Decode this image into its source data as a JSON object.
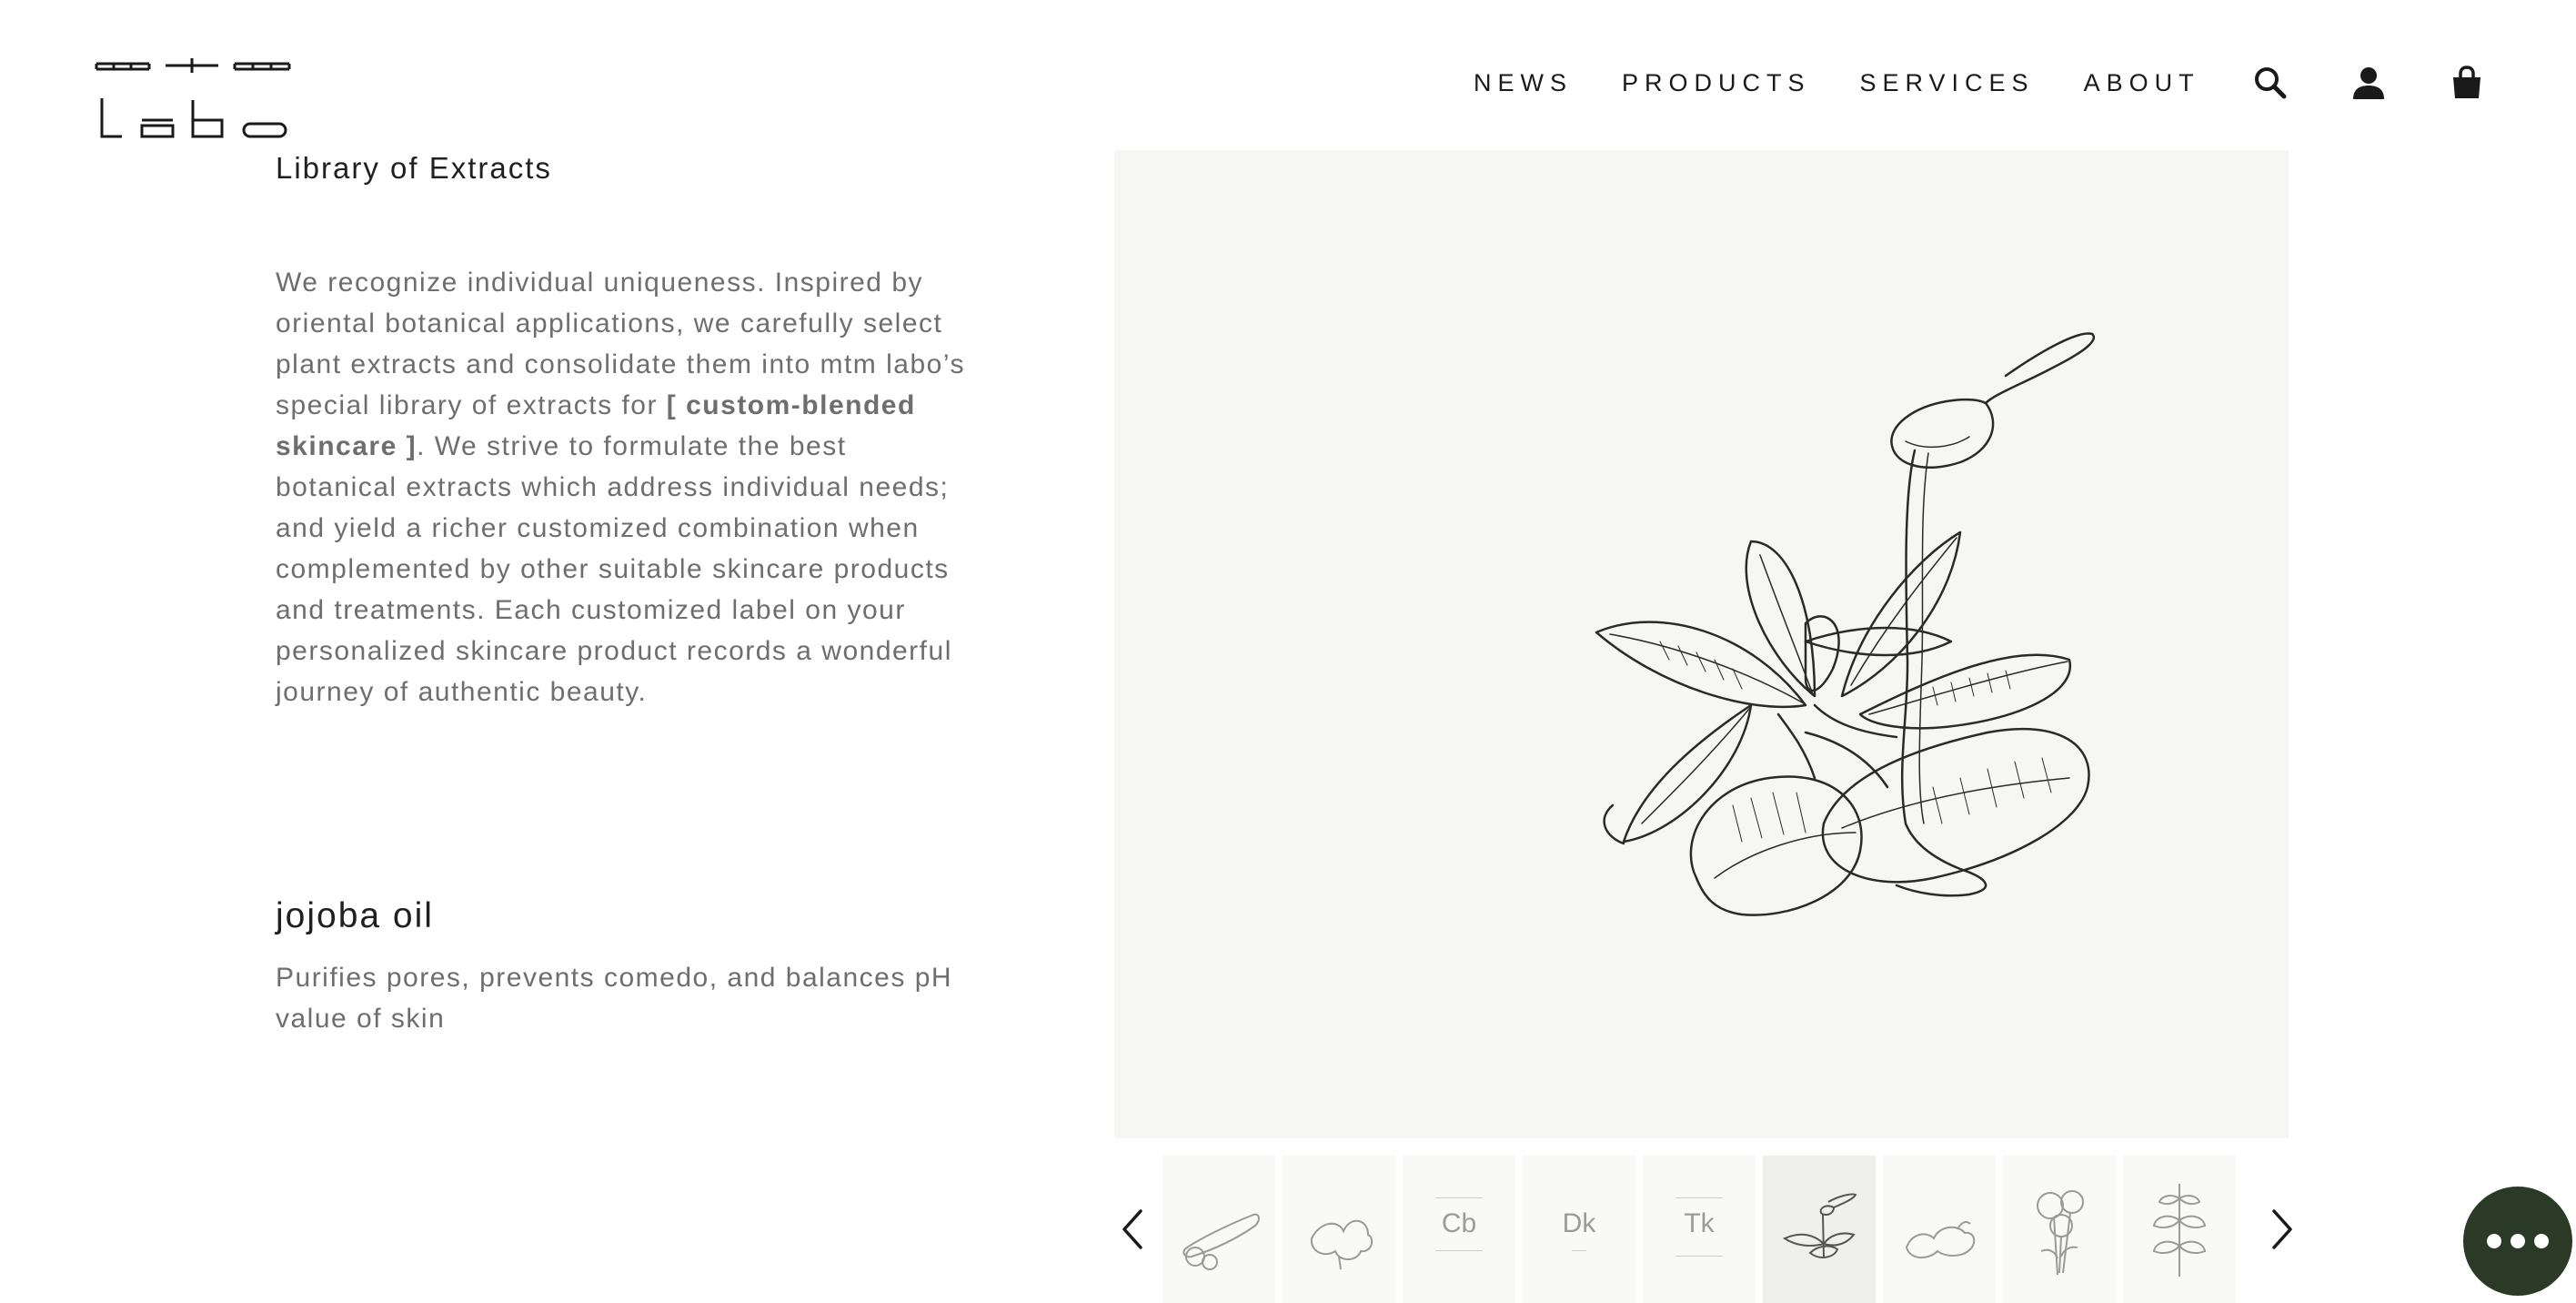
{
  "brand": {
    "logo_text": "mtm labo"
  },
  "nav": {
    "links": [
      "NEWS",
      "PRODUCTS",
      "SERVICES",
      "ABOUT"
    ],
    "icons": [
      "search-icon",
      "account-icon",
      "cart-icon"
    ]
  },
  "content": {
    "section_title": "Library of Extracts",
    "intro_before": "We recognize individual uniqueness. Inspired by oriental botanical applications, we carefully select plant extracts and consolidate them into mtm labo’s special library of extracts for ",
    "intro_bold": "[ custom-blended skincare ]",
    "intro_after": ". We strive to formulate the best botanical extracts which address individual needs; and yield a richer customized combination when complemented by other suitable skincare products and treatments. Each customized label on your personalized skincare product records a wonderful journey of authentic beauty.",
    "extract": {
      "name": "jojoba oil",
      "description": "Purifies pores, prevents comedo, and balances pH value of skin"
    }
  },
  "gallery": {
    "selected_index": 5,
    "thumbnails": [
      {
        "kind": "illustration",
        "icon": "cucumber-icon",
        "code": ""
      },
      {
        "kind": "illustration",
        "icon": "herb-icon",
        "code": ""
      },
      {
        "kind": "label",
        "icon": "label-icon",
        "code": "Cb"
      },
      {
        "kind": "label",
        "icon": "label-icon",
        "code": "Dk"
      },
      {
        "kind": "label",
        "icon": "label-icon",
        "code": "Tk"
      },
      {
        "kind": "illustration",
        "icon": "jojoba-icon",
        "code": ""
      },
      {
        "kind": "illustration",
        "icon": "ginger-icon",
        "code": ""
      },
      {
        "kind": "illustration",
        "icon": "flower-icon",
        "code": ""
      },
      {
        "kind": "illustration",
        "icon": "nettle-icon",
        "code": ""
      }
    ]
  },
  "colors": {
    "text_dark": "#1a1a1a",
    "text_muted": "#6e6e6e",
    "panel_bg": "#f6f6f4",
    "chat_bg": "#2b3a26"
  }
}
